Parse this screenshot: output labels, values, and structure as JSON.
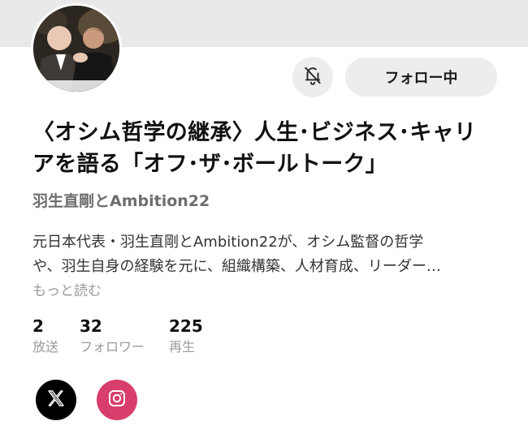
{
  "header": {
    "mute_icon": "bell-slash-icon",
    "follow_label": "フォロー中"
  },
  "show": {
    "title_line1": "〈オシム哲学の継承〉人生･ビジネス･キャリ",
    "title_line2": "アを語る「オフ･ザ･ボールトーク」",
    "author": "羽生直剛とAmbition22",
    "description_line1": "元日本代表・羽生直剛とAmbition22が、オシム監督の哲学",
    "description_line2": "や、羽生自身の経験を元に、組織構築、人材育成、リーダー…",
    "more_label": "もっと読む"
  },
  "stats": [
    {
      "value": "2",
      "label": "放送"
    },
    {
      "value": "32",
      "label": "フォロワー"
    },
    {
      "value": "225",
      "label": "再生"
    }
  ],
  "social": [
    {
      "icon": "x-logo-icon",
      "color": "#000000"
    },
    {
      "icon": "instagram-icon",
      "color": "#d83e6c"
    }
  ]
}
